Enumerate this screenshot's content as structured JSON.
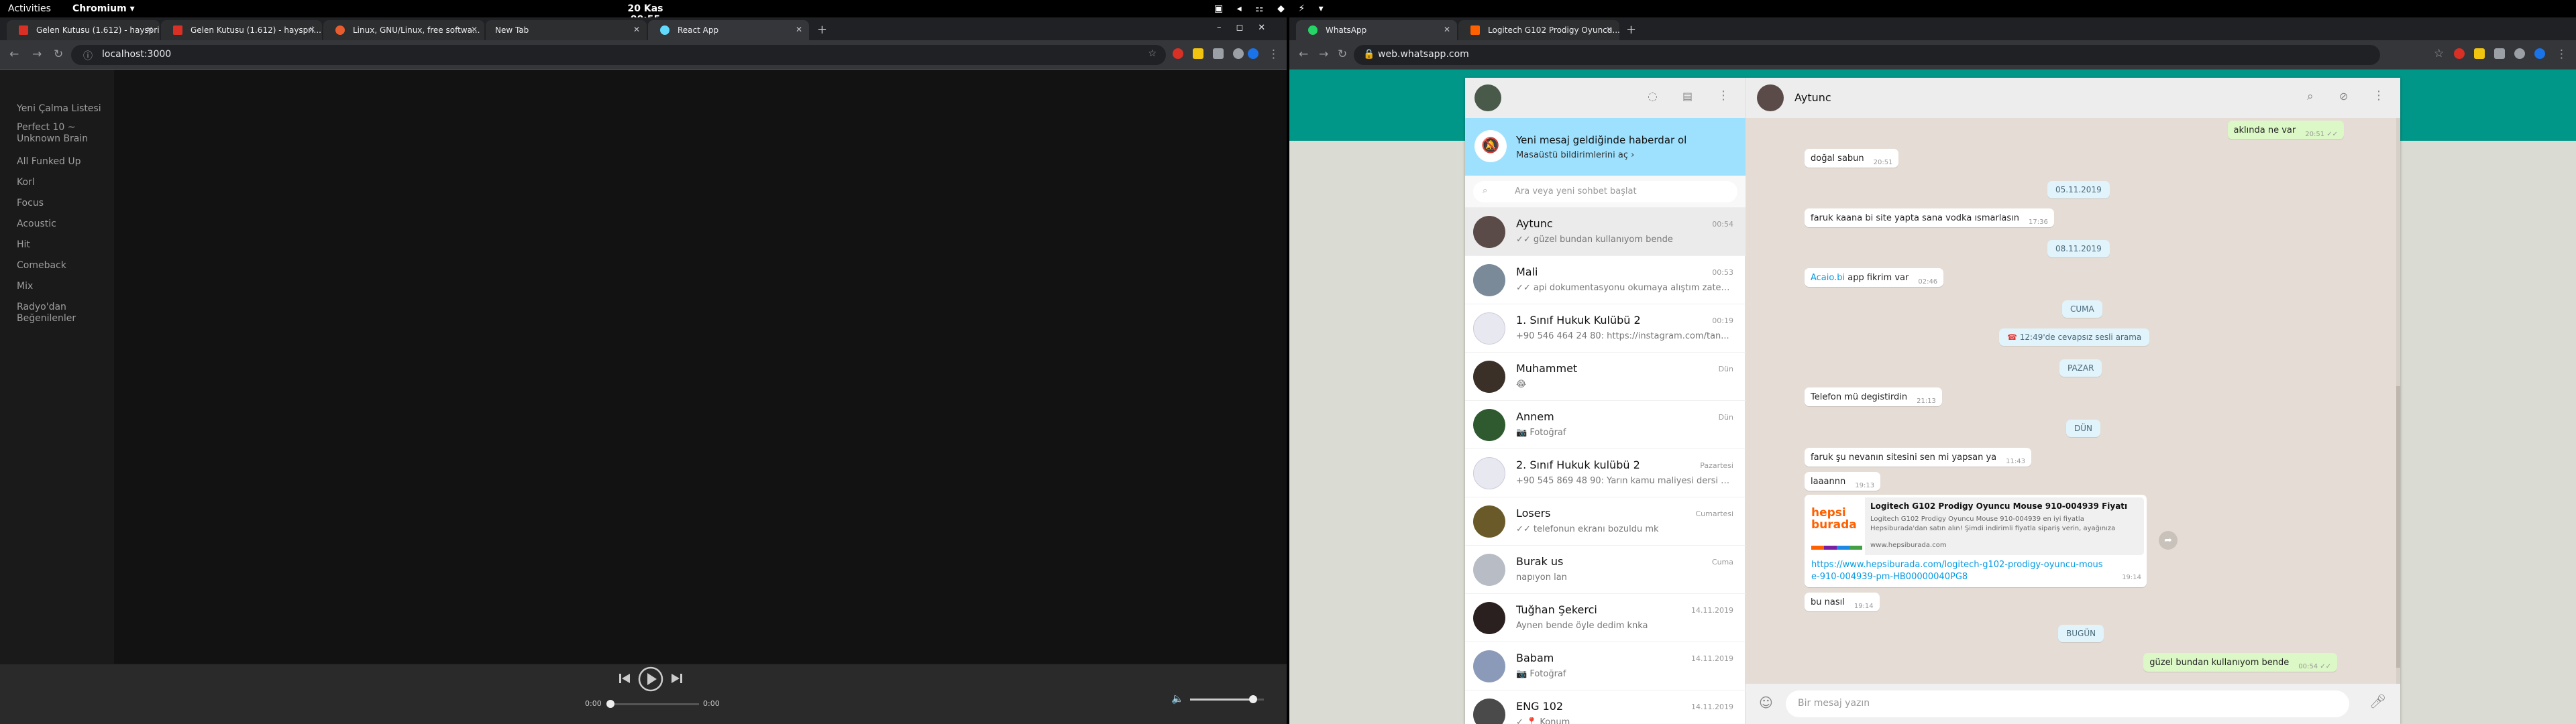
{
  "topbar": {
    "activities": "Activities",
    "app_name": "Chromium ▾",
    "clock": "20 Kas  00:55"
  },
  "win1": {
    "tabs": [
      {
        "label": "Gelen Kutusu (1.612) - hayspri..."
      },
      {
        "label": "Gelen Kutusu (1.612) - hayspri..."
      },
      {
        "label": "Linux, GNU/Linux, free softwa..."
      },
      {
        "label": "New Tab"
      },
      {
        "label": "React App"
      }
    ],
    "url": "localhost:3000",
    "sidebar": [
      "Yeni Çalma Listesi",
      "Perfect 10 ~ Unknown Brain",
      "All Funked Up",
      "Korl",
      "Focus",
      "Acoustic",
      "Hit",
      "Comeback",
      "Mix",
      "Radyo'dan Beğenilenler"
    ],
    "player": {
      "time_current": "0:00",
      "time_total": "0:00",
      "progress": 0,
      "volume": 0.85
    }
  },
  "win2": {
    "tabs": [
      {
        "label": "WhatsApp"
      },
      {
        "label": "Logitech G102 Prodigy Oyuncu..."
      }
    ],
    "url": "web.whatsapp.com",
    "notif": {
      "title": "Yeni mesaj geldiğinde haberdar ol",
      "sub": "Masaüstü bildirimlerini aç ›"
    },
    "search_placeholder": "Ara veya yeni sohbet başlat",
    "chats": [
      {
        "name": "Aytunc",
        "time": "00:54",
        "msg": "✓✓ güzel bundan kullanıyom bende"
      },
      {
        "name": "Mali",
        "time": "00:53",
        "msg": "✓✓ api dokumentasyonu okumaya alıştım zaten :D"
      },
      {
        "name": "1. Sınıf Hukuk Kulübü 2",
        "time": "00:19",
        "msg": "+90 546 464 24 80: https://instagram.com/tan..."
      },
      {
        "name": "Muhammet",
        "time": "Dün",
        "msg": "😂"
      },
      {
        "name": "Annem",
        "time": "Dün",
        "msg": "📷 Fotoğraf"
      },
      {
        "name": "2. Sınıf Hukuk kulübü 2",
        "time": "Pazartesi",
        "msg": "+90 545 869 48 90: Yarın kamu maliyesi dersi yo..."
      },
      {
        "name": "Losers",
        "time": "Cumartesi",
        "msg": "✓✓ telefonun ekranı bozuldu mk"
      },
      {
        "name": "Burak us",
        "time": "Cuma",
        "msg": "napıyon lan"
      },
      {
        "name": "Tuğhan Şekerci",
        "time": "14.11.2019",
        "msg": "Aynen bende öyle dedim knka"
      },
      {
        "name": "Babam",
        "time": "14.11.2019",
        "msg": "📷 Fotoğraf"
      },
      {
        "name": "ENG 102",
        "time": "14.11.2019",
        "msg": "✓ 📍 Konum"
      }
    ],
    "chat_name": "Aytunc",
    "messages": {
      "m1": {
        "text": "aklında ne var",
        "time": "20:51 ✓✓"
      },
      "m2": {
        "text": "doğal sabun",
        "time": "20:51"
      },
      "d1": "05.11.2019",
      "m3": {
        "text": "faruk kaana bi site yapta sana vodka ısmarlasın",
        "time": "17:36"
      },
      "d2": "08.11.2019",
      "m4_link": "Acaio.bi",
      "m4": {
        "text": " app fikrim var",
        "time": "02:46"
      },
      "d3": "CUMA",
      "call": "12:49'de cevapsız sesli arama",
      "d4": "PAZAR",
      "m5": {
        "text": "Telefon mü degistirdin",
        "time": "21:13"
      },
      "d5": "DÜN",
      "m6": {
        "text": "faruk şu nevanın sitesini sen mi yapsan ya",
        "time": "11:43"
      },
      "m7": {
        "text": "laaannn",
        "time": "19:13"
      },
      "preview": {
        "logo": "hepsi burada",
        "title": "Logitech G102 Prodigy Oyuncu Mouse 910-004939 Fiyatı",
        "desc": "Logitech G102 Prodigy Oyuncu Mouse 910-004939 en iyi fiyatla Hepsiburada'dan satın alın! Şimdi indirimli fiyatla sipariş verin, ayağınıza",
        "domain": "www.hepsiburada.com",
        "url": "https://www.hepsiburada.com/logitech-g102-prodigy-oyuncu-mouse-910-004939-pm-HB00000040PG8",
        "time": "19:14"
      },
      "m8": {
        "text": "bu nasıl",
        "time": "19:14"
      },
      "d6": "BUGÜN",
      "m9": {
        "text": "güzel bundan kullanıyom bende",
        "time": "00:54 ✓✓"
      }
    },
    "compose_placeholder": "Bir mesaj yazın"
  },
  "colors": {
    "wa_teal": "#009688",
    "wa_out": "#dcf8c6",
    "chrome_dark": "#35363a"
  }
}
